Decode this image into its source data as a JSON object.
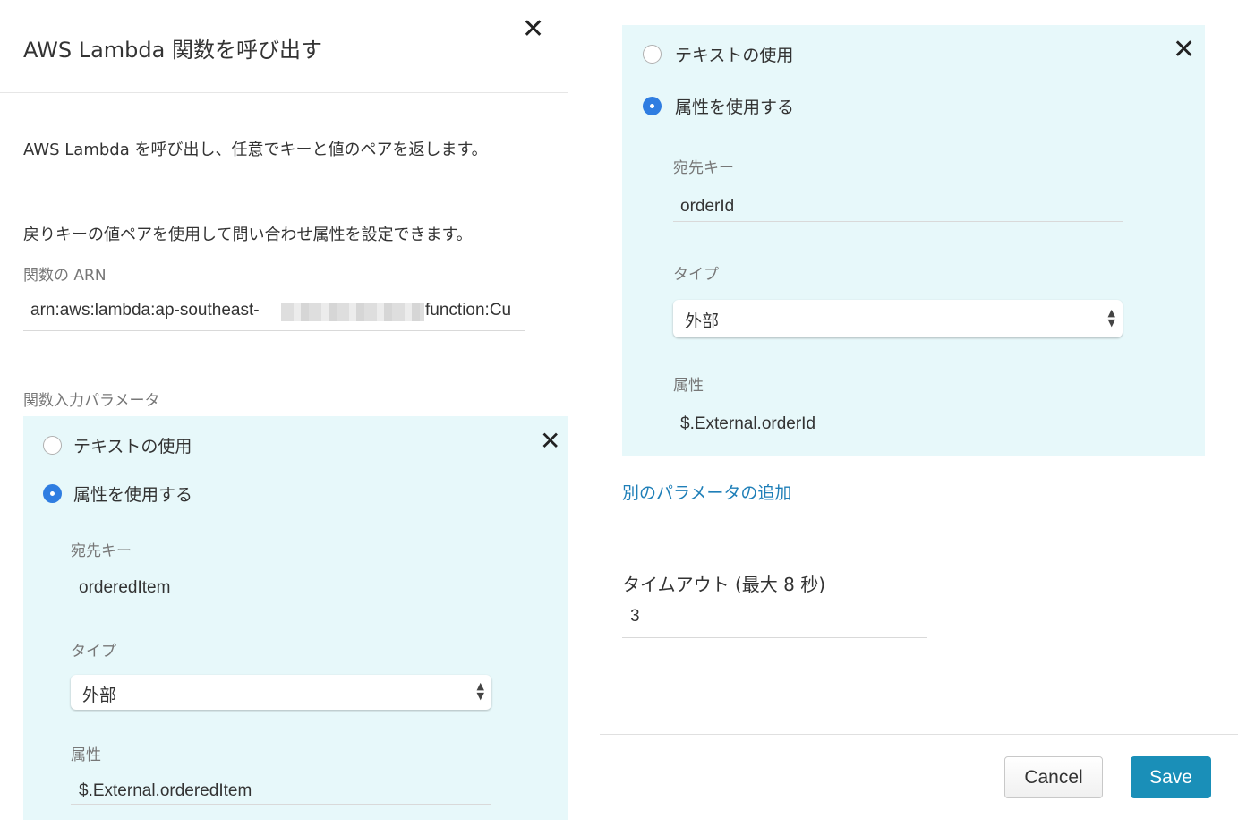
{
  "dialog": {
    "title": "AWS Lambda 関数を呼び出す",
    "close_glyph": "✕",
    "description": "AWS Lambda を呼び出し、任意でキーと値のペアを返します。",
    "return_info": "戻りキーの値ペアを使用して問い合わせ属性を設定できます。",
    "arn_label": "関数の ARN",
    "arn_prefix": "arn:aws:lambda:ap-southeast-",
    "arn_suffix": "function:Cu",
    "params_label": "関数入力パラメータ"
  },
  "parameters": [
    {
      "option_text": "テキストの使用",
      "option_attribute": "属性を使用する",
      "selected": "attribute",
      "dest_key_label": "宛先キー",
      "dest_key_value": "orderedItem",
      "type_label": "タイプ",
      "type_value": "外部",
      "attribute_label": "属性",
      "attribute_value": "$.External.orderedItem"
    },
    {
      "option_text": "テキストの使用",
      "option_attribute": "属性を使用する",
      "selected": "attribute",
      "dest_key_label": "宛先キー",
      "dest_key_value": "orderId",
      "type_label": "タイプ",
      "type_value": "外部",
      "attribute_label": "属性",
      "attribute_value": "$.External.orderId"
    }
  ],
  "add_param_link": "別のパラメータの追加",
  "timeout": {
    "label": "タイムアウト (最大 8 秒)",
    "value": "3"
  },
  "buttons": {
    "cancel": "Cancel",
    "save": "Save"
  },
  "colors": {
    "param_background": "#e7f8fa",
    "radio_selected": "#2f7de1",
    "link": "#1f7fb8",
    "save_button": "#1a8fb8"
  },
  "icons": {
    "close": "close-icon",
    "select_arrows": "chevron-up-down-icon"
  }
}
